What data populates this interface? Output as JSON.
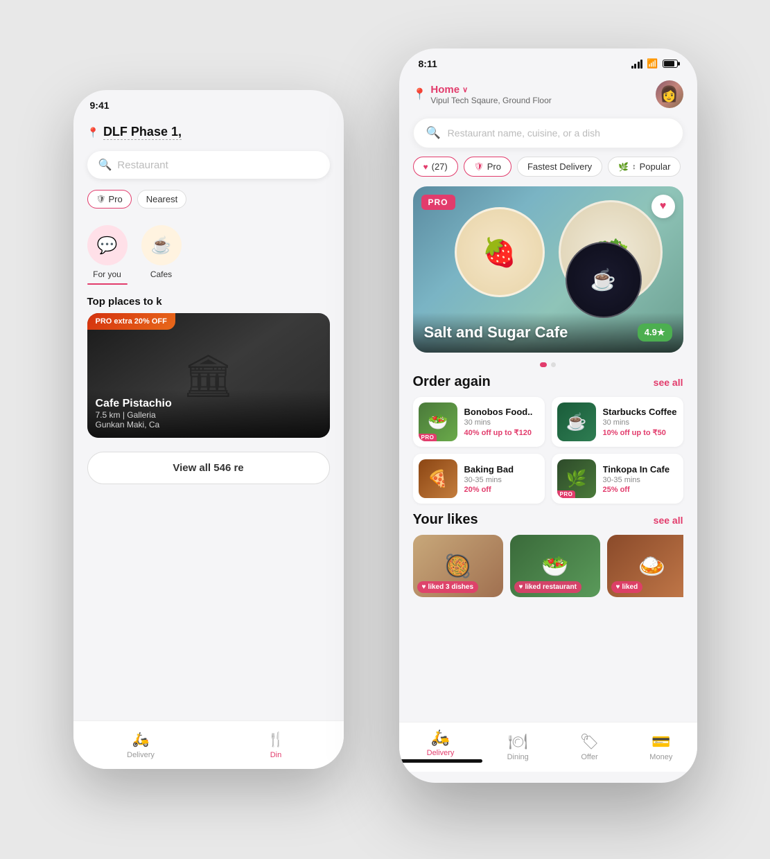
{
  "back_phone": {
    "time": "9:41",
    "location": "DLF Phase 1,",
    "search_placeholder": "Restaurant",
    "chips": [
      "Pro",
      "Nearest"
    ],
    "categories": [
      {
        "icon": "💬",
        "label": "For you",
        "active": true
      },
      {
        "icon": "☕",
        "label": "Cafes",
        "active": false
      }
    ],
    "promo_section_title": "Top places to k",
    "promo_badge": "PRO extra 20% OFF",
    "promo_restaurant_name": "Cafe Pistachio",
    "promo_sub": "7.5 km | Galleria",
    "promo_extra": "Gunkan Maki, Ca",
    "view_all": "View all 546 re",
    "nav_items": [
      {
        "icon": "🛵",
        "label": "Delivery",
        "active": false
      },
      {
        "icon": "🍴",
        "label": "Din",
        "active": true
      }
    ]
  },
  "front_phone": {
    "time": "8:11",
    "location_name": "Home",
    "location_address": "Vipul Tech Sqaure, Ground Floor",
    "search_placeholder": "Restaurant name, cuisine, or a dish",
    "filter_chips": [
      {
        "label": "(27)",
        "type": "likes"
      },
      {
        "label": "Pro",
        "type": "pro"
      },
      {
        "label": "Fastest Delivery",
        "type": "normal"
      },
      {
        "label": "Popular",
        "type": "sort"
      }
    ],
    "hero": {
      "restaurant_name": "Salt and Sugar Cafe",
      "rating": "4.9★",
      "pro_badge": "PRO"
    },
    "order_again": {
      "title": "Order again",
      "see_all": "see all",
      "items": [
        {
          "name": "Bonobos Food..",
          "time": "30 mins",
          "discount": "40% off up to ₹120",
          "has_pro": true,
          "emoji": "🥗"
        },
        {
          "name": "Starbucks Coffee",
          "time": "30 mins",
          "discount": "10% off up to ₹50",
          "has_pro": false,
          "emoji": "☕"
        },
        {
          "name": "Baking Bad",
          "time": "30-35 mins",
          "discount": "20% off",
          "has_pro": false,
          "emoji": "🍕"
        },
        {
          "name": "Tinkopa In Cafe",
          "time": "30-35 mins",
          "discount": "25% off",
          "has_pro": true,
          "emoji": "🌿"
        }
      ]
    },
    "your_likes": {
      "title": "Your likes",
      "see_all": "see all",
      "items": [
        {
          "label": "liked 3 dishes",
          "emoji": "🥘"
        },
        {
          "label": "liked restaurant",
          "emoji": "🥗"
        },
        {
          "label": "liked",
          "emoji": "🍛"
        }
      ]
    },
    "nav_items": [
      {
        "icon": "🛵",
        "label": "Delivery",
        "active": true
      },
      {
        "icon": "🍽",
        "label": "Dining",
        "active": false
      },
      {
        "icon": "🏷",
        "label": "Offer",
        "active": false
      },
      {
        "icon": "💳",
        "label": "Money",
        "active": false
      }
    ]
  }
}
